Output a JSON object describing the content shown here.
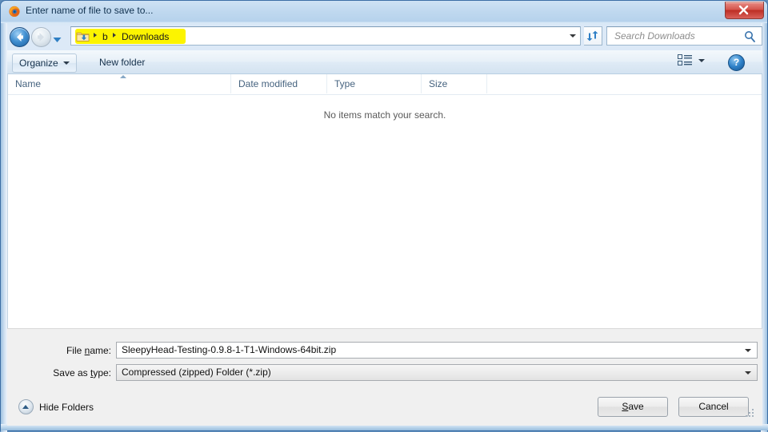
{
  "window": {
    "title": "Enter name of file to save to...",
    "app_icon": "firefox-icon",
    "close_label": "×"
  },
  "navbar": {
    "back_icon": "back-arrow-icon",
    "forward_icon": "forward-arrow-icon",
    "recent_icon": "chevron-down-icon",
    "folder_icon": "downloads-folder-icon",
    "breadcrumbs": [
      "b",
      "Downloads"
    ],
    "highlight_color": "#fcf400",
    "dropdown_icon": "chevron-down-icon",
    "refresh_icon": "refresh-icon",
    "search": {
      "placeholder": "Search Downloads",
      "value": "",
      "icon": "search-icon"
    }
  },
  "toolbar": {
    "organize_label": "Organize",
    "new_folder_label": "New folder",
    "view_icon": "list-view-icon",
    "view_caret_icon": "chevron-down-icon",
    "help_icon": "help-icon",
    "help_label": "?"
  },
  "filelist": {
    "columns": [
      "Name",
      "Date modified",
      "Type",
      "Size"
    ],
    "sort_indicator_icon": "sort-ascending-icon",
    "empty_message": "No items match your search.",
    "rows": []
  },
  "bottom": {
    "filename": {
      "label_pre": "File ",
      "label_accel": "n",
      "label_post": "ame:",
      "value": "SleepyHead-Testing-0.9.8-1-T1-Windows-64bit.zip",
      "dropdown_icon": "chevron-down-icon"
    },
    "savetype": {
      "label_pre": "Save as ",
      "label_accel": "t",
      "label_post": "ype:",
      "value": "Compressed (zipped) Folder (*.zip)",
      "dropdown_icon": "chevron-down-icon"
    },
    "hide_folders_label": "Hide Folders",
    "hide_folders_icon": "chevron-up-circle-icon",
    "save_pre": "",
    "save_accel": "S",
    "save_post": "ave",
    "cancel_label": "Cancel"
  }
}
